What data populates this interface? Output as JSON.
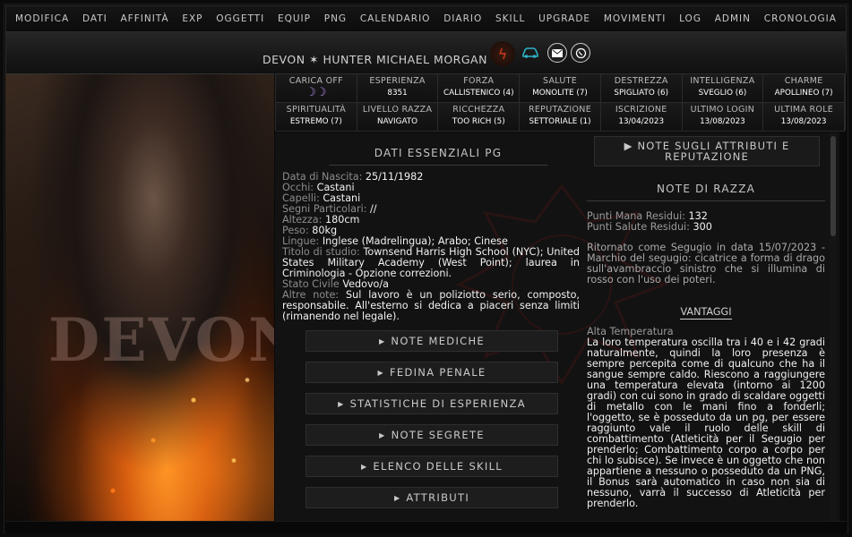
{
  "nav": [
    "MODIFICA",
    "DATI",
    "AFFINITÀ",
    "EXP",
    "OGGETTI",
    "EQUIP",
    "PNG",
    "CALENDARIO",
    "DIARIO",
    "SKILL",
    "UPGRADE",
    "MOVIMENTI",
    "LOG",
    "ADMIN",
    "CRONOLOGIA"
  ],
  "header": {
    "name": "DEVON ✶ HUNTER MICHAEL MORGAN",
    "icons": [
      "fire-icon",
      "car-icon",
      "mail-icon",
      "whatsapp-icon"
    ]
  },
  "portrait": {
    "overlay_text": "DEVON"
  },
  "stats_row1": [
    {
      "label": "CARICA OFF",
      "value": "☽☽"
    },
    {
      "label": "ESPERIENZA",
      "value": "8351"
    },
    {
      "label": "FORZA",
      "value": "CALLISTENICO (4)"
    },
    {
      "label": "SALUTE",
      "value": "MONOLITE (7)"
    },
    {
      "label": "DESTREZZA",
      "value": "SPIGLIATO (6)"
    },
    {
      "label": "INTELLIGENZA",
      "value": "SVEGLIO (6)"
    },
    {
      "label": "CHARME",
      "value": "APOLLINEO (7)"
    }
  ],
  "stats_row2": [
    {
      "label": "SPIRITUALITÀ",
      "value": "ESTREMO (7)"
    },
    {
      "label": "LIVELLO RAZZA",
      "value": "NAVIGATO"
    },
    {
      "label": "RICCHEZZA",
      "value": "TOO RICH (5)"
    },
    {
      "label": "REPUTAZIONE",
      "value": "SETTORIALE (1)"
    },
    {
      "label": "ISCRIZIONE",
      "value": "13/04/2023"
    },
    {
      "label": "ULTIMO LOGIN",
      "value": "13/08/2023"
    },
    {
      "label": "ULTIMA ROLE",
      "value": "13/08/2023"
    }
  ],
  "essentials": {
    "title": "DATI ESSENZIALI PG",
    "rows": [
      {
        "k": "Data di Nascita: ",
        "v": "25/11/1982"
      },
      {
        "k": "Occhi: ",
        "v": "Castani"
      },
      {
        "k": "Capelli: ",
        "v": "Castani"
      },
      {
        "k": "Segni Particolari: ",
        "v": "//"
      },
      {
        "k": "Altezza: ",
        "v": "180cm"
      },
      {
        "k": "Peso: ",
        "v": "80kg"
      },
      {
        "k": "Lingue: ",
        "v": "Inglese (Madrelingua); Arabo; Cinese"
      },
      {
        "k": "Titolo di studio: ",
        "v": "Townsend Harris High School (NYC); United States Military Academy (West Point); laurea in Criminologia - Opzione correzioni."
      },
      {
        "k": "Stato Civile ",
        "v": "Vedovo/a"
      },
      {
        "k": "Altre note: ",
        "v": "Sul lavoro è un poliziotto serio, composto, responsabile. All'esterno si dedica a piaceri senza limiti (rimanendo nel legale)."
      }
    ]
  },
  "toggles": [
    "NOTE MEDICHE",
    "FEDINA PENALE",
    "STATISTICHE DI ESPERIENZA",
    "NOTE SEGRETE",
    "ELENCO DELLE SKILL",
    "ATTRIBUTI"
  ],
  "right": {
    "notes_toggle": "NOTE SUGLI ATTRIBUTI E REPUTAZIONE",
    "race_title": "NOTE DI RAZZA",
    "mana_label": "Punti Mana Residui: ",
    "mana_value": "132",
    "health_label": "Punti Salute Residui: ",
    "health_value": "300",
    "description": "Ritornato come Segugio in data 15/07/2023 - Marchio del segugio: cicatrice a forma di drago sull'avambraccio sinistro che si illumina di rosso con l'uso dei poteri.",
    "advantages_title": "VANTAGGI",
    "advantage_name": "Alta Temperatura",
    "advantage_text": "La loro temperatura oscilla tra i 40 e i 42 gradi naturalmente, quindi la loro presenza è sempre percepita come di qualcuno che ha il sangue sempre caldo. Riescono a raggiungere una temperatura elevata (intorno ai 1200 gradi) con cui sono in grado di scaldare oggetti di metallo con le mani fino a fonderli; l'oggetto, se è posseduto da un pg, per essere raggiunto vale il ruolo delle skill di combattimento (Atleticità per il Segugio per prenderlo; Combattimento corpo a corpo per chi lo subisce). Se invece è un oggetto che non appartiene a nessuno o posseduto da un PNG, il Bonus sarà automatico in caso non sia di nessuno, varrà il successo di Atleticità per prenderlo."
  },
  "colors": {
    "background": "#121212",
    "accent_moon": "#b48ae6",
    "fire": "#d23a1c",
    "car": "#2fb2c8"
  }
}
